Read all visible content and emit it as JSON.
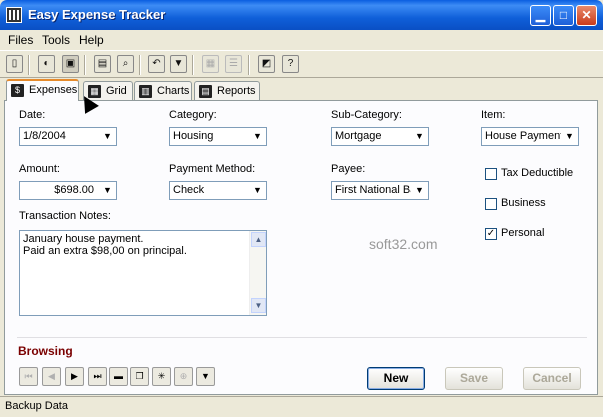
{
  "window": {
    "title": "Easy Expense Tracker"
  },
  "menu": [
    "Files",
    "Tools",
    "Help"
  ],
  "tabs": [
    {
      "label": "Expenses",
      "icon": "dollar-icon"
    },
    {
      "label": "Grid",
      "icon": "grid-icon"
    },
    {
      "label": "Charts",
      "icon": "chart-icon"
    },
    {
      "label": "Reports",
      "icon": "report-icon"
    }
  ],
  "form": {
    "date": {
      "label": "Date:",
      "value": "1/8/2004"
    },
    "category": {
      "label": "Category:",
      "value": "Housing"
    },
    "subcategory": {
      "label": "Sub-Category:",
      "value": "Mortgage"
    },
    "item": {
      "label": "Item:",
      "value": "House Payment"
    },
    "amount": {
      "label": "Amount:",
      "value": "$698.00"
    },
    "payment_method": {
      "label": "Payment Method:",
      "value": "Check"
    },
    "payee": {
      "label": "Payee:",
      "value": "First National Bank"
    },
    "notes": {
      "label": "Transaction Notes:",
      "value": "January house payment.\nPaid an extra $98,00 on principal."
    },
    "checks": [
      {
        "label": "Tax Deductible",
        "checked": false
      },
      {
        "label": "Business",
        "checked": false
      },
      {
        "label": "Personal",
        "checked": true
      }
    ]
  },
  "watermark": "soft32.com",
  "mode_label": "Browsing",
  "buttons": {
    "new": "New",
    "save": "Save",
    "cancel": "Cancel"
  },
  "status": "Backup Data",
  "colors": {
    "mode_label": "#7a0000",
    "title_bar": "#0a5ee0"
  }
}
